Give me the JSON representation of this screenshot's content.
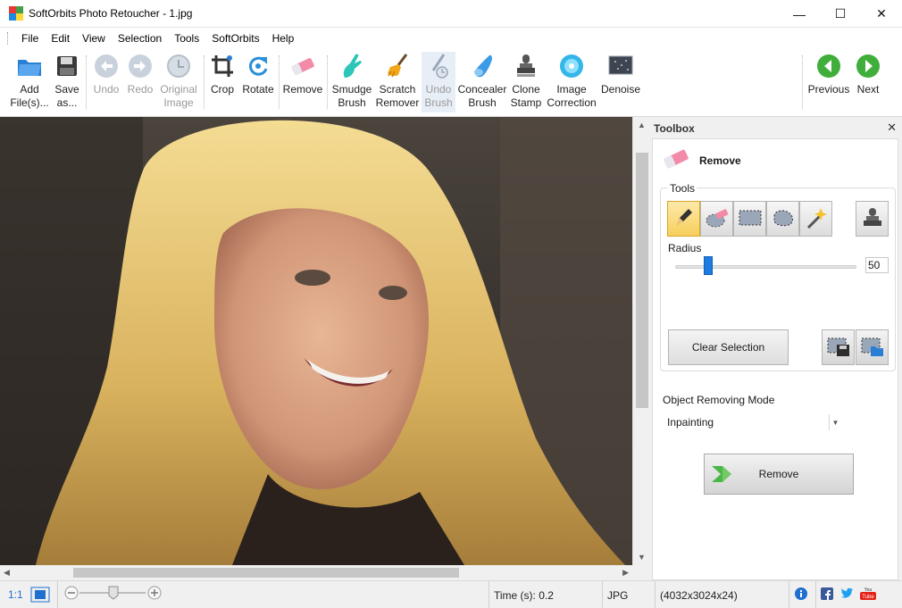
{
  "window": {
    "title": "SoftOrbits Photo Retoucher - 1.jpg",
    "minimize": "—",
    "maximize": "☐",
    "close": "✕"
  },
  "menu": [
    "File",
    "Edit",
    "View",
    "Selection",
    "Tools",
    "SoftOrbits",
    "Help"
  ],
  "toolbar": {
    "add_files": [
      "Add",
      "File(s)..."
    ],
    "save_as": [
      "Save",
      "as..."
    ],
    "undo": "Undo",
    "redo": "Redo",
    "original_image": [
      "Original",
      "Image"
    ],
    "crop": "Crop",
    "rotate": "Rotate",
    "remove": "Remove",
    "smudge_brush": [
      "Smudge",
      "Brush"
    ],
    "scratch_remover": [
      "Scratch",
      "Remover"
    ],
    "undo_brush": [
      "Undo",
      "Brush"
    ],
    "concealer_brush": [
      "Concealer",
      "Brush"
    ],
    "clone_stamp": [
      "Clone",
      "Stamp"
    ],
    "image_correction": [
      "Image",
      "Correction"
    ],
    "denoise": "Denoise",
    "previous": "Previous",
    "next": "Next"
  },
  "toolbox": {
    "title": "Toolbox",
    "close": "✕",
    "heading": "Remove",
    "tools_group": "Tools",
    "radius_label": "Radius",
    "radius_value": "50",
    "radius_fraction": 0.18,
    "clear_selection": "Clear Selection",
    "mode_label": "Object Removing Mode",
    "mode_value": "Inpainting",
    "remove_button": "Remove"
  },
  "statusbar": {
    "zoom_ratio": "1:1",
    "time": "Time (s): 0.2",
    "format": "JPG",
    "dimensions": "(4032x3024x24)"
  },
  "colors": {
    "accent_blue": "#1e7be0",
    "selected_tool": "#f6cf5b",
    "nav_green": "#3fae3a"
  }
}
